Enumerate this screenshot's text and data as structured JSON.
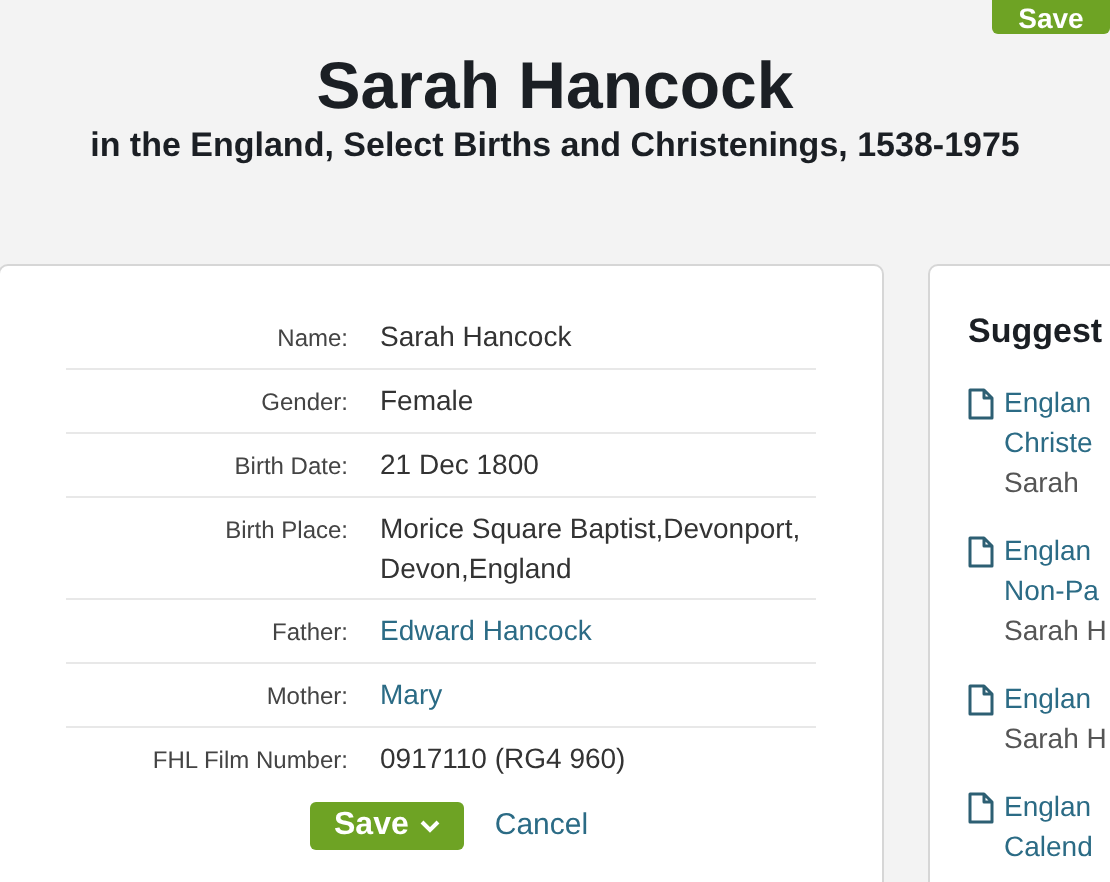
{
  "top_save_button": "Save",
  "title": "Sarah Hancock",
  "subtitle": "in the England, Select Births and Christenings, 1538-1975",
  "record": [
    {
      "label": "Name:",
      "value": "Sarah Hancock",
      "kind": "text"
    },
    {
      "label": "Gender:",
      "value": "Female",
      "kind": "text"
    },
    {
      "label": "Birth Date:",
      "value": "21 Dec 1800",
      "kind": "text"
    },
    {
      "label": "Birth Place:",
      "value": "Morice Square Baptist,Devonport,Devon,England",
      "kind": "text"
    },
    {
      "label": "Father:",
      "value": "Edward Hancock",
      "kind": "link"
    },
    {
      "label": "Mother:",
      "value": "Mary",
      "kind": "link"
    },
    {
      "label": "FHL Film Number:",
      "value": "0917110 (RG4 960)",
      "kind": "text"
    }
  ],
  "actions": {
    "save": "Save",
    "cancel": "Cancel"
  },
  "suggestions": {
    "title": "Suggest",
    "items": [
      {
        "lines": [
          "Englan",
          "Christe"
        ],
        "person": "Sarah"
      },
      {
        "lines": [
          "Englan",
          "Non-Pa"
        ],
        "person": "Sarah H"
      },
      {
        "lines": [
          "Englan"
        ],
        "person": "Sarah H"
      },
      {
        "lines": [
          "Englan",
          "Calend"
        ]
      }
    ]
  }
}
